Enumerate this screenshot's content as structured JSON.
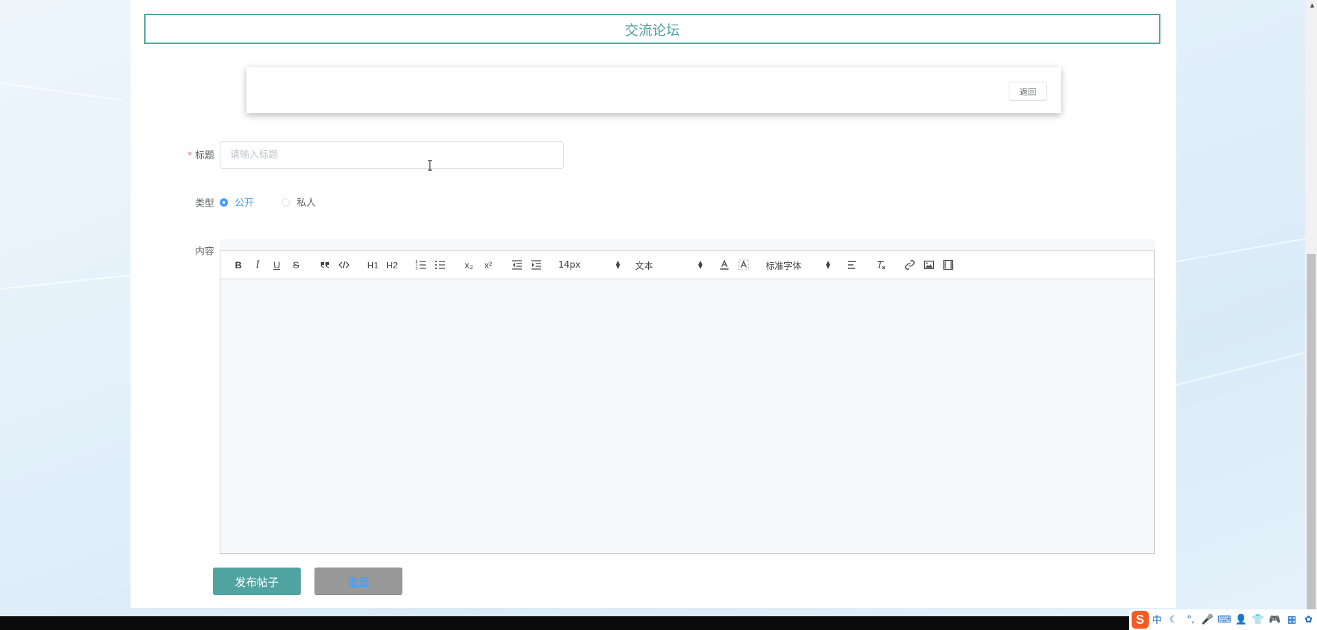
{
  "header": {
    "title": "交流论坛"
  },
  "top_card": {
    "back_label": "返回"
  },
  "form": {
    "title_label": "标题",
    "title_required_mark": "*",
    "title_placeholder": "请输入标题",
    "title_value": "",
    "type_label": "类型",
    "type_options": [
      "公开",
      "私人"
    ],
    "type_selected": "公开",
    "content_label": "内容"
  },
  "editor": {
    "toolbar": {
      "bold": "B",
      "italic": "I",
      "underline": "U",
      "strike": "S",
      "h1": "H1",
      "h2": "H2",
      "sub": "x₂",
      "sup": "x²",
      "size_value": "14px",
      "header_value": "文本",
      "font_value": "标准字体",
      "clean": "Tx"
    }
  },
  "buttons": {
    "publish": "发布帖子",
    "reset": "重置"
  },
  "ime": {
    "logo": "S",
    "items": [
      "中",
      "☾",
      "°,",
      "🎤",
      "⌨",
      "👤",
      "👕",
      "🎮",
      "▦",
      "✿"
    ]
  },
  "colors": {
    "accent": "#4fa3a1",
    "primary": "#409eff",
    "danger": "#f56c6c"
  }
}
